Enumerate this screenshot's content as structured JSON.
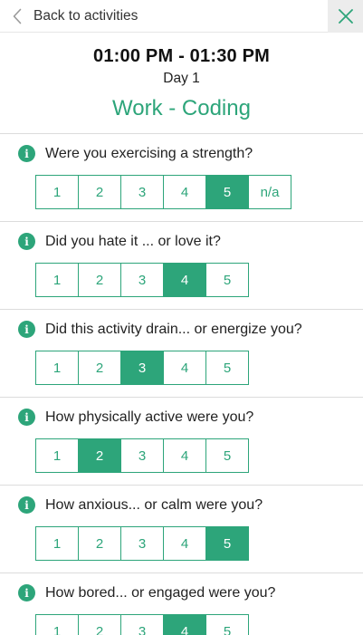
{
  "nav": {
    "back_label": "Back to activities",
    "back_icon": "chevron-left-icon",
    "close_icon": "close-icon"
  },
  "header": {
    "time": "01:00 PM - 01:30 PM",
    "day": "Day 1",
    "activity": "Work - Coding"
  },
  "accent_color": "#2da57a",
  "questions": [
    {
      "text": "Were you exercising a strength?",
      "options": [
        "1",
        "2",
        "3",
        "4",
        "5",
        "n/a"
      ],
      "selected": "5"
    },
    {
      "text": "Did you hate it ... or love it?",
      "options": [
        "1",
        "2",
        "3",
        "4",
        "5"
      ],
      "selected": "4"
    },
    {
      "text": "Did this activity drain... or energize you?",
      "options": [
        "1",
        "2",
        "3",
        "4",
        "5"
      ],
      "selected": "3"
    },
    {
      "text": "How physically active were you?",
      "options": [
        "1",
        "2",
        "3",
        "4",
        "5"
      ],
      "selected": "2"
    },
    {
      "text": "How anxious... or calm were you?",
      "options": [
        "1",
        "2",
        "3",
        "4",
        "5"
      ],
      "selected": "5"
    },
    {
      "text": "How bored... or engaged were you?",
      "options": [
        "1",
        "2",
        "3",
        "4",
        "5"
      ],
      "selected": "4"
    }
  ]
}
